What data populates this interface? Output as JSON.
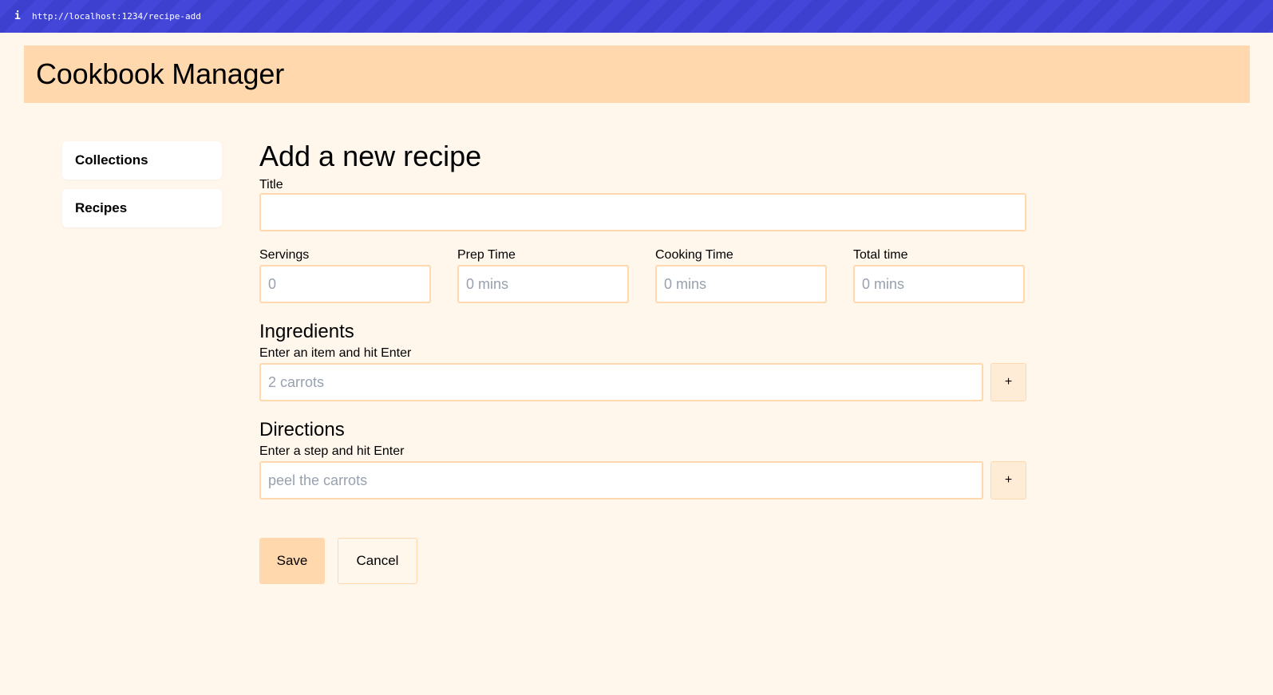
{
  "browser": {
    "info_icon": "i",
    "url": "http://localhost:1234/recipe-add"
  },
  "header": {
    "title": "Cookbook Manager"
  },
  "sidebar": {
    "items": [
      {
        "label": "Collections"
      },
      {
        "label": "Recipes"
      }
    ]
  },
  "form": {
    "heading": "Add a new recipe",
    "title": {
      "label": "Title",
      "value": "",
      "placeholder": ""
    },
    "servings": {
      "label": "Servings",
      "placeholder": "0"
    },
    "prep_time": {
      "label": "Prep Time",
      "placeholder": "0 mins"
    },
    "cooking_time": {
      "label": "Cooking Time",
      "placeholder": "0 mins"
    },
    "total_time": {
      "label": "Total time",
      "placeholder": "0 mins"
    },
    "ingredients": {
      "heading": "Ingredients",
      "hint": "Enter an item and hit Enter",
      "placeholder": "2 carrots",
      "add_label": "+"
    },
    "directions": {
      "heading": "Directions",
      "hint": "Enter a step and hit Enter",
      "placeholder": "peel the carrots",
      "add_label": "+"
    },
    "save_label": "Save",
    "cancel_label": "Cancel"
  },
  "colors": {
    "url_bar": "#4346d9",
    "header_bg": "#ffd8ad",
    "page_bg": "#fff6ec",
    "input_border": "#ffd8ad",
    "placeholder": "#98a1ad"
  }
}
